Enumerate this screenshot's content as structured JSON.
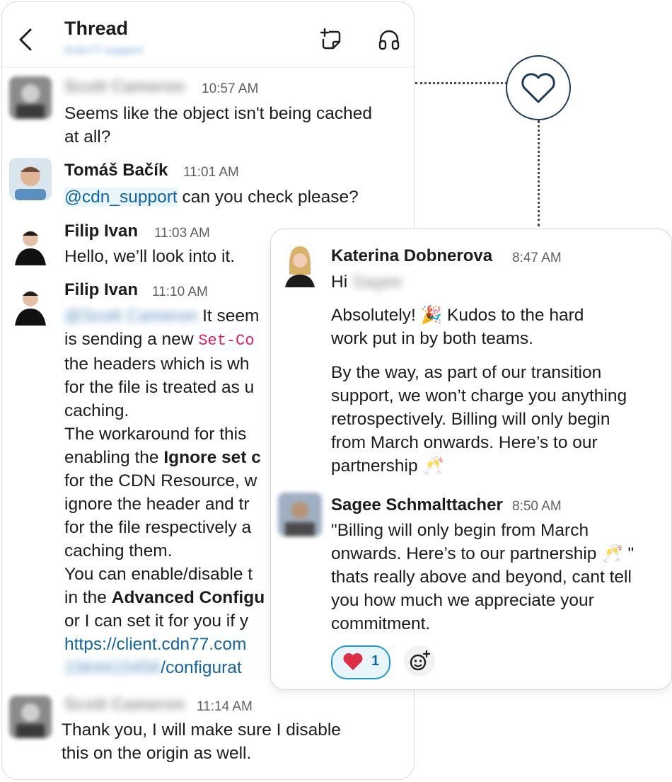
{
  "header": {
    "title": "Thread",
    "channel": "#cdn77-support"
  },
  "messages": [
    {
      "author": "Scott Cameron",
      "time": "10:57 AM",
      "lines": [
        "Seems like the object isn't being cached",
        "at all?"
      ]
    },
    {
      "author": "Tomáš Bačík",
      "time": "11:01 AM",
      "mention": "@cdn_support",
      "text": " can you check please?"
    },
    {
      "author": "Filip Ivan",
      "time": "11:03 AM",
      "text": "Hello, we’ll look into it."
    },
    {
      "author": "Filip Ivan",
      "time": "11:10 AM",
      "line1_mention": "@Scott Cameron",
      "line1_text": " It seem",
      "line2_text": "is sending a new ",
      "line2_code": "Set-Co",
      "lines": [
        "the headers which is wh",
        "for the file is treated as u",
        "caching."
      ],
      "line6_text": "The workaround for this",
      "line7_text": "enabling the ",
      "line7_bold": "Ignore set c",
      "lines2": [
        "for the CDN Resource, w",
        "ignore the header and tr",
        "for the file respectively a",
        "caching them.",
        "You can enable/disable t"
      ],
      "line13_text": "in the ",
      "line13_bold": "Advanced Configu",
      "line14_text": "or I can set it for you if y",
      "link1": "https://client.cdn77.com",
      "link2_blur": "1564415456",
      "link2": "/configurat"
    },
    {
      "author": "Scott Cameron",
      "time": "11:14 AM",
      "lines": [
        "Thank you, I will make sure I disable",
        "this on the origin as well."
      ]
    }
  ],
  "reply_panel": {
    "msg1": {
      "author": "Katerina Dobnerova",
      "time": "8:47 AM",
      "greeting": "Hi",
      "greeting_name": "Sagee",
      "p1_line1_a": "Absolutely! ",
      "p1_line1_b": " Kudos to the hard",
      "p1_line2": "work put in by both teams.",
      "p2_lines": [
        "By the way, as part of our transition",
        "support, we won’t charge you anything",
        "retrospectively. Billing will only begin",
        "from March onwards. Here’s to our"
      ],
      "p2_last": "partnership "
    },
    "msg2": {
      "author": "Sagee Schmalttacher",
      "time": "8:50 AM",
      "line1": "\"Billing will only begin from March",
      "line2_a": "onwards. Here’s to our partnership ",
      "line2_b": " \"",
      "lines": [
        "thats really above and beyond, cant tell",
        "you how much we appreciate your",
        "commitment."
      ]
    },
    "reaction": {
      "emoji": "red-heart",
      "count": "1"
    }
  },
  "colors": {
    "link": "#1264a3",
    "code": "#e01e5a",
    "heart_outline": "#1c3a5c",
    "reaction_border": "#1d9bd1"
  }
}
